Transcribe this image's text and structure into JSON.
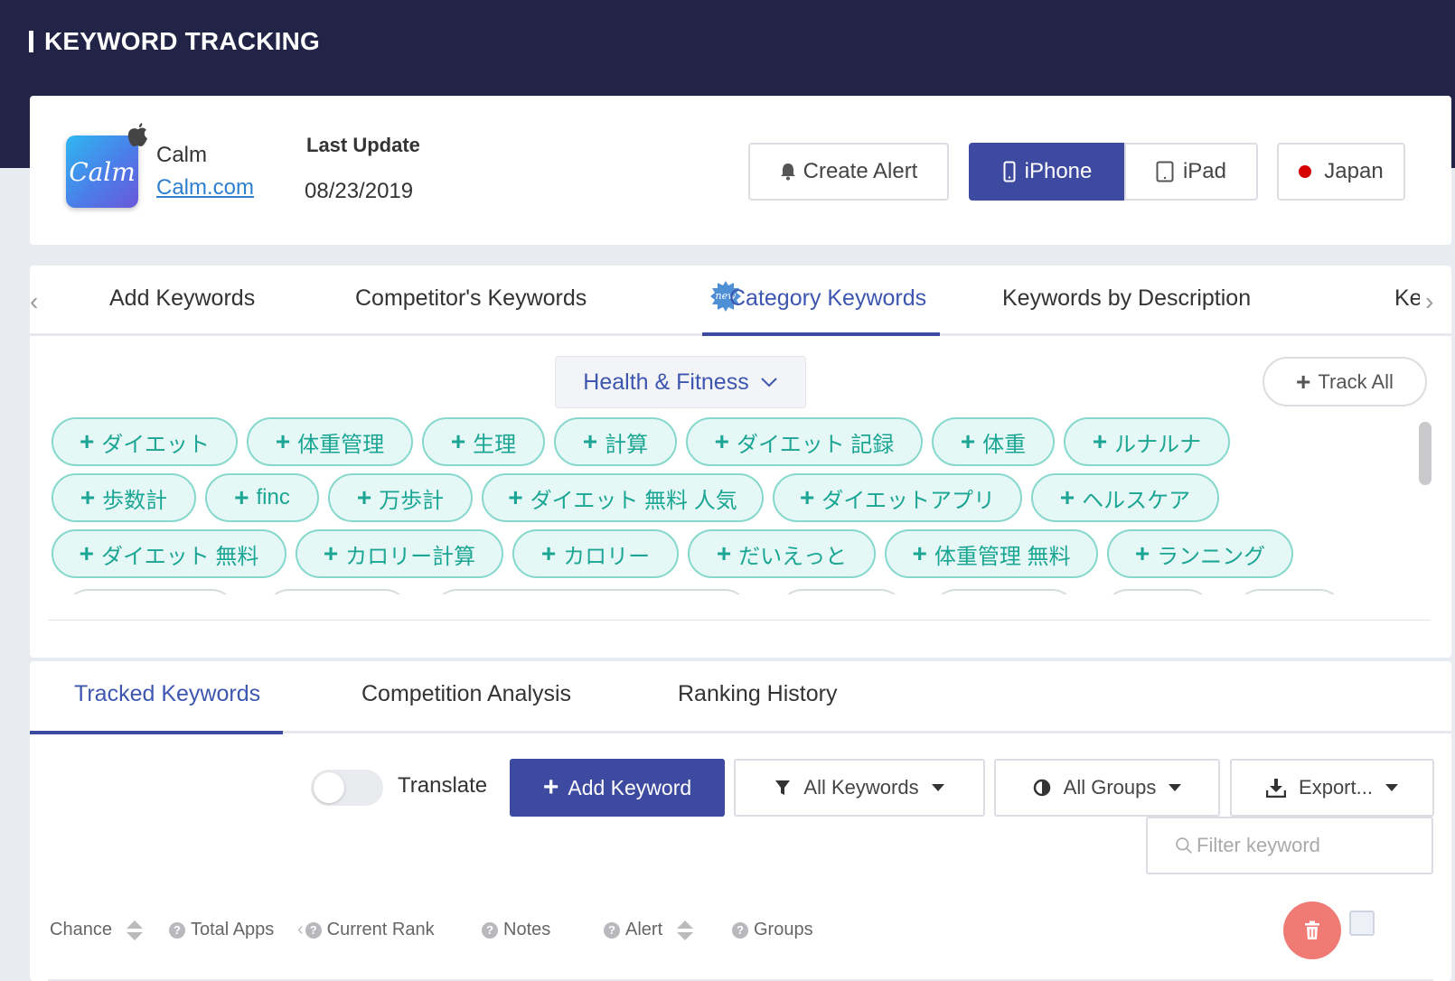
{
  "header": {
    "title": "KEYWORD TRACKING"
  },
  "app": {
    "name": "Calm",
    "icon_text": "Calm",
    "link": "Calm.com",
    "last_update_label": "Last Update",
    "last_update": "08/23/2019",
    "icon_gradient": [
      "#2fb7f2",
      "#4b7de8",
      "#6a57d8"
    ]
  },
  "actions": {
    "create_alert": "Create Alert",
    "device_iphone": "iPhone",
    "device_ipad": "iPad",
    "selected_device": "iPhone",
    "country": "Japan"
  },
  "keyword_tabs": {
    "items": [
      {
        "label": "Add Keywords"
      },
      {
        "label": "Competitor's Keywords"
      },
      {
        "label": "Category Keywords",
        "badge": "new",
        "active": true
      },
      {
        "label": "Keywords by Description"
      },
      {
        "label": "Ke"
      }
    ]
  },
  "category": {
    "selected": "Health & Fitness",
    "track_all": "Track All"
  },
  "suggested_keywords": [
    [
      "ダイエット",
      "体重管理",
      "生理",
      "計算",
      "ダイエット 記録",
      "体重",
      "ルナルナ"
    ],
    [
      "歩数計",
      "finc",
      "万歩計",
      "ダイエット 無料 人気",
      "ダイエットアプリ",
      "ヘルスケア"
    ],
    [
      "ダイエット 無料",
      "カロリー計算",
      "カロリー",
      "だいえっと",
      "体重管理 無料",
      "ランニング"
    ]
  ],
  "tracked_tabs": {
    "items": [
      {
        "label": "Tracked Keywords",
        "active": true
      },
      {
        "label": "Competition Analysis"
      },
      {
        "label": "Ranking History"
      }
    ]
  },
  "toolbar": {
    "translate_label": "Translate",
    "translate_on": false,
    "add_keyword": "Add Keyword",
    "filter_all_keywords": "All Keywords",
    "filter_all_groups": "All Groups",
    "export": "Export...",
    "filter_placeholder": "Filter keyword"
  },
  "table": {
    "columns": [
      "Chance",
      "Total Apps",
      "Current Rank",
      "Notes",
      "Alert",
      "Groups"
    ]
  },
  "colors": {
    "header_bg": "#212447",
    "primary": "#3d4a9f",
    "accent_text": "#3d56b0",
    "pill_bg": "#e6f8f6",
    "pill_border": "#86d8cd",
    "pill_text": "#1ba594",
    "delete": "#f07a74",
    "country_dot": "#d60000"
  }
}
